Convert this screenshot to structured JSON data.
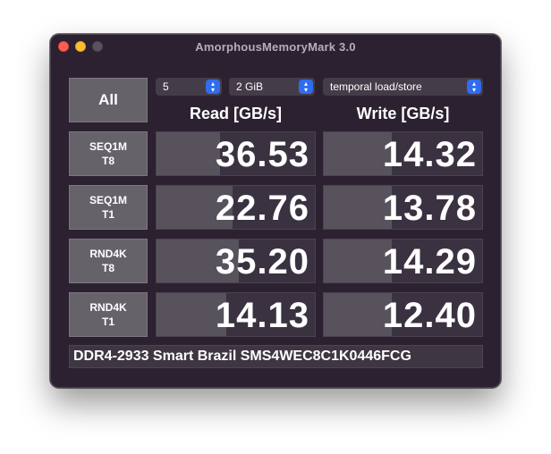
{
  "window": {
    "title": "AmorphousMemoryMark 3.0"
  },
  "controls": {
    "all_label": "All",
    "count": "5",
    "size": "2 GiB",
    "mode": "temporal load/store"
  },
  "headers": {
    "read": "Read [GB/s]",
    "write": "Write [GB/s]"
  },
  "rows": [
    {
      "label1": "SEQ1M",
      "label2": "T8",
      "read": "36.53",
      "write": "14.32",
      "read_fraction": 0.4,
      "write_fraction": 0.43
    },
    {
      "label1": "SEQ1M",
      "label2": "T1",
      "read": "22.76",
      "write": "13.78",
      "read_fraction": 0.48,
      "write_fraction": 0.43
    },
    {
      "label1": "RND4K",
      "label2": "T8",
      "read": "35.20",
      "write": "14.29",
      "read_fraction": 0.52,
      "write_fraction": 0.43
    },
    {
      "label1": "RND4K",
      "label2": "T1",
      "read": "14.13",
      "write": "12.40",
      "read_fraction": 0.44,
      "write_fraction": 0.43
    }
  ],
  "device": "DDR4-2933 Smart Brazil SMS4WEC8C1K0446FCG",
  "colors": {
    "window_bg": "#2b2130",
    "button_bg": "#66626a",
    "cell_bg": "#3a3240",
    "bar_fill": "#57525b",
    "accent": "#2f6cf0",
    "close": "#fe5f57",
    "minimize": "#febc2e"
  }
}
